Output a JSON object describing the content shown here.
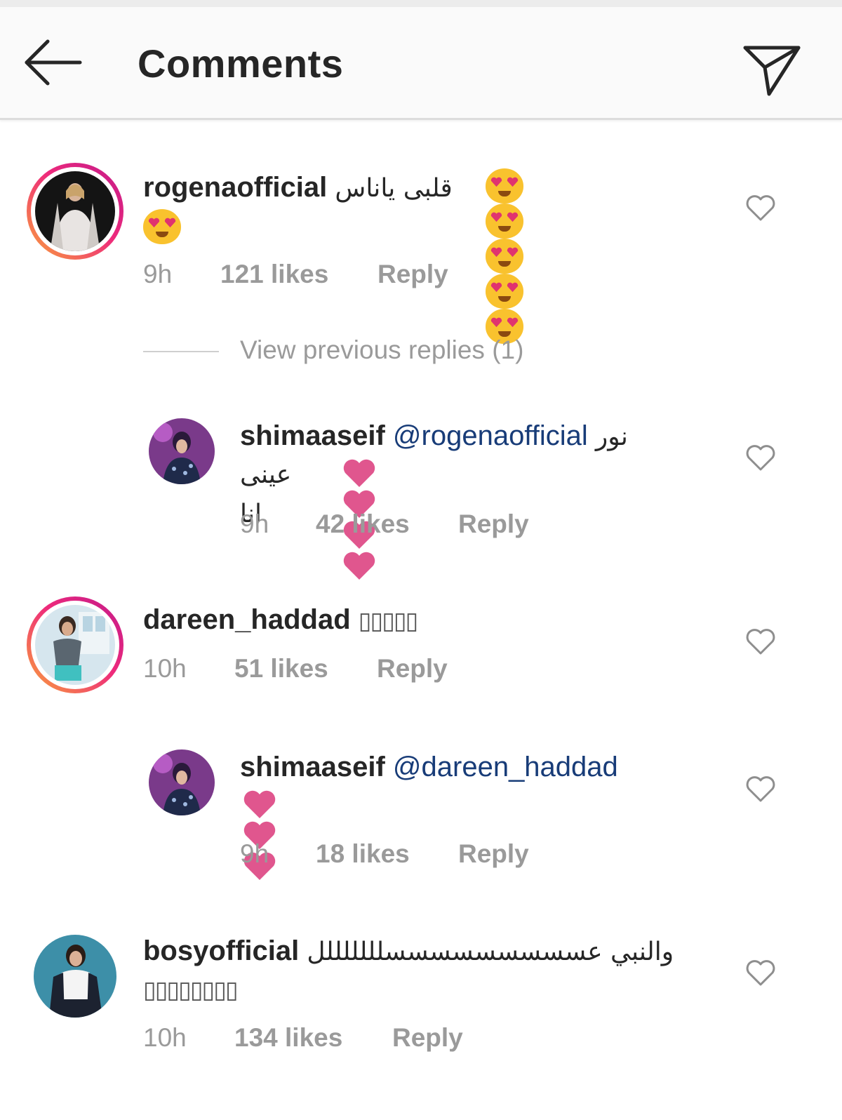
{
  "header": {
    "title": "Comments"
  },
  "colors": {
    "username": "#262626",
    "mention": "#183c78",
    "meta": "#9a9a9a",
    "heart": "#e0568e",
    "emoji": "#f9c22e"
  },
  "comments": [
    {
      "username": "rogenaofficial",
      "text_ar": "قلبى ياناس",
      "emoji": "smiling-face-with-heart-eyes",
      "emoji_count": 6,
      "time": "9h",
      "likes": "121 likes",
      "reply": "Reply",
      "avatar_ring": true
    },
    {
      "username": "shimaaseif",
      "mention": "@rogenaofficial",
      "text_ar_1": "نور",
      "text_ar_2": "عينى انا",
      "emoji": "pink-heart",
      "emoji_count": 4,
      "time": "9h",
      "likes": "42 likes",
      "reply": "Reply",
      "is_reply": true
    },
    {
      "username": "dareen_haddad",
      "text_boxes": "▯▯▯▯▯",
      "time": "10h",
      "likes": "51 likes",
      "reply": "Reply",
      "avatar_ring": true
    },
    {
      "username": "shimaaseif",
      "mention": "@dareen_haddad",
      "emoji": "pink-heart",
      "emoji_count": 3,
      "time": "9h",
      "likes": "18 likes",
      "reply": "Reply",
      "is_reply": true
    },
    {
      "username": "bosyofficial",
      "text_ar": "والنبي عسسسسسسسسسلللللللل",
      "text_boxes": "▯▯▯▯▯▯▯▯",
      "time": "10h",
      "likes": "134 likes",
      "reply": "Reply"
    }
  ],
  "view_previous_replies": "View previous replies (1)"
}
